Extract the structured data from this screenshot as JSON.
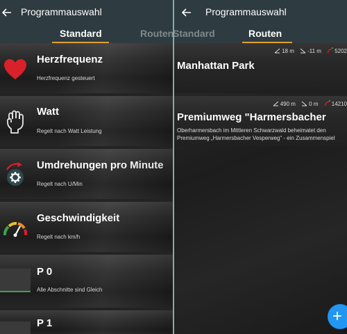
{
  "left": {
    "title": "Programmauswahl",
    "tabs": [
      {
        "label": "Standard"
      },
      {
        "label": "Routen"
      }
    ],
    "items": [
      {
        "title": "Herzfrequenz",
        "subtitle": "Herzfrequenz gesteuert",
        "icon": "heart-icon",
        "icon_color": "#d8212b"
      },
      {
        "title": "Watt",
        "subtitle": "Regelt nach Watt Leistung",
        "icon": "fist-icon"
      },
      {
        "title": "Umdrehungen pro Minute",
        "subtitle": "Regelt nach U/Min",
        "icon": "rpm-gear-icon",
        "icon_color": "#d8212b"
      },
      {
        "title": "Geschwindigkeit",
        "subtitle": "Regelt nach km/h",
        "icon": "speedometer-icon"
      },
      {
        "title": "P 0",
        "subtitle": "Alle Abschnitte sind Gleich",
        "icon": "profile-thumbnail"
      },
      {
        "title": "P 1",
        "subtitle": "",
        "icon": "profile-thumbnail"
      }
    ]
  },
  "right": {
    "title": "Programmauswahl",
    "tabs": [
      {
        "label": "Standard"
      },
      {
        "label": "Routen"
      }
    ],
    "routes": [
      {
        "title": "Manhattan Park",
        "ascent": "18 m",
        "descent": "-11 m",
        "distance": "5202",
        "description": ""
      },
      {
        "title": "Premiumweg \"Harmersbacher",
        "ascent": "490 m",
        "descent": "0 m",
        "distance": "14210",
        "description": "Oberharmersbach im Mittleren Schwarzwald beheimatet den Premiumweg „Harmersbacher Vesperweg“ - ein Zusammenspiel"
      }
    ],
    "fab_label": "+"
  },
  "colors": {
    "appbar": "#2e3b40",
    "tab_indicator": "#e0a22c",
    "divider": "#8fa9a6",
    "fab": "#2196f3",
    "accent_red": "#d8212b"
  }
}
